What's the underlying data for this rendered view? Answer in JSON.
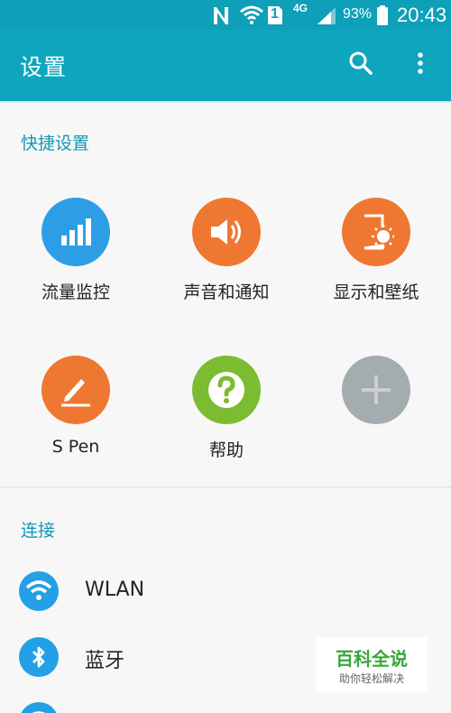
{
  "status_bar": {
    "battery": "93%",
    "time": "20:43",
    "network": "4G",
    "sim": "1"
  },
  "app_bar": {
    "title": "设置"
  },
  "quick_settings": {
    "header": "快捷设置",
    "tiles": [
      {
        "label": "流量监控",
        "color": "#2d9ee6",
        "icon": "signal-bars-icon"
      },
      {
        "label": "声音和通知",
        "color": "#ee7832",
        "icon": "speaker-icon"
      },
      {
        "label": "显示和壁纸",
        "color": "#ee7832",
        "icon": "display-brightness-icon"
      },
      {
        "label": "S Pen",
        "color": "#ee7832",
        "icon": "pen-icon"
      },
      {
        "label": "帮助",
        "color": "#7bbc31",
        "icon": "help-icon"
      },
      {
        "label": "",
        "color": "#a4acb0",
        "icon": "plus-icon"
      }
    ]
  },
  "connections": {
    "header": "连接",
    "items": [
      {
        "label": "WLAN",
        "icon": "wifi-icon"
      },
      {
        "label": "蓝牙",
        "icon": "bluetooth-icon"
      }
    ]
  },
  "watermark": {
    "main": "百科全说",
    "sub": "助你轻松解决"
  }
}
